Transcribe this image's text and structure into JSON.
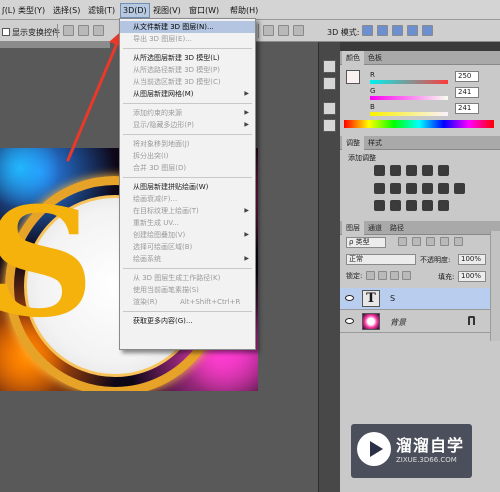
{
  "menubar": {
    "items": [
      "ʃ(L)",
      "类型(Y)",
      "选择(S)",
      "滤镜(T)",
      "3D(D)",
      "视图(V)",
      "窗口(W)",
      "帮助(H)"
    ],
    "active_index": 4
  },
  "optionsbar": {
    "show_transform_label": "显示变换控件",
    "mode_3d_label": "3D 模式:"
  },
  "dropdown": {
    "groups": [
      [
        {
          "label": "从文件新建 3D 图层(N)...",
          "enabled": true,
          "highlight": true
        },
        {
          "label": "导出 3D 图层(E)...",
          "enabled": false
        }
      ],
      [
        {
          "label": "从所选图层新建 3D 模型(L)",
          "enabled": true
        },
        {
          "label": "从所选路径新建 3D 模型(P)",
          "enabled": false
        },
        {
          "label": "从当前选区新建 3D 模型(C)",
          "enabled": false
        },
        {
          "label": "从图层新建网格(M)",
          "enabled": true,
          "submenu": true
        }
      ],
      [
        {
          "label": "添加约束的来源",
          "enabled": false,
          "submenu": true
        },
        {
          "label": "显示/隐藏多边形(P)",
          "enabled": false,
          "submenu": true
        }
      ],
      [
        {
          "label": "将对象移到地面(J)",
          "enabled": false
        },
        {
          "label": "拆分出突(I)",
          "enabled": false
        },
        {
          "label": "合并 3D 图层(D)",
          "enabled": false
        }
      ],
      [
        {
          "label": "从图层新建拼贴绘画(W)",
          "enabled": true
        },
        {
          "label": "绘画衰减(F)...",
          "enabled": false
        },
        {
          "label": "在目标纹理上绘画(T)",
          "enabled": false,
          "submenu": true
        },
        {
          "label": "重新生成 UV...",
          "enabled": false
        },
        {
          "label": "创建绘图叠加(V)",
          "enabled": false,
          "submenu": true
        },
        {
          "label": "选择可绘画区域(B)",
          "enabled": false
        },
        {
          "label": "绘画系统",
          "enabled": false,
          "submenu": true
        }
      ],
      [
        {
          "label": "从 3D 图层生成工作路径(K)",
          "enabled": false
        },
        {
          "label": "使用当前画笔素描(S)",
          "enabled": false
        },
        {
          "label": "渲染(R)",
          "enabled": false,
          "shortcut": "Alt+Shift+Ctrl+R"
        }
      ],
      [
        {
          "label": "获取更多内容(G)...",
          "enabled": true
        }
      ]
    ]
  },
  "color_panel": {
    "tabs": [
      "颜色",
      "色板"
    ],
    "channels": [
      {
        "label": "R",
        "value": "250"
      },
      {
        "label": "G",
        "value": "241"
      },
      {
        "label": "B",
        "value": "241"
      }
    ]
  },
  "adjust_panel": {
    "tabs": [
      "调整",
      "样式"
    ],
    "title": "添加调整"
  },
  "layers_panel": {
    "tabs": [
      "图层",
      "通道",
      "路径"
    ],
    "filter_type": "ρ 类型",
    "blend_mode": "正常",
    "opacity_label": "不透明度:",
    "opacity_value": "100%",
    "lock_label": "锁定:",
    "fill_label": "填充:",
    "fill_value": "100%",
    "layers": [
      {
        "name": "S",
        "kind": "text",
        "thumb_letter": "T",
        "selected": true
      },
      {
        "name": "背景",
        "kind": "image",
        "locked": true,
        "selected": false
      }
    ]
  },
  "artwork": {
    "letter": "S"
  },
  "watermark": {
    "title": "溜溜自学",
    "url": "ZIXUE.3D66.COM"
  },
  "colors": {
    "menu_highlight": "#b3c5e0",
    "arrow_red": "#e8392a",
    "layer_selected": "#b9cdee",
    "slider_r": "#ff3b3b",
    "slider_g": "#2fd32f",
    "slider_b": "#3b5bff"
  }
}
